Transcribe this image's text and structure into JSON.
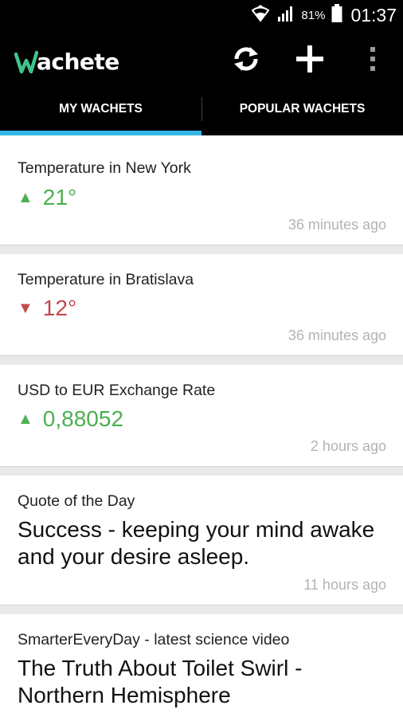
{
  "status_bar": {
    "battery": "81%",
    "time": "01:37"
  },
  "app": {
    "name": "achete"
  },
  "icons": {
    "refresh": "refresh-icon",
    "add": "add-icon",
    "more": "more-vert-icon"
  },
  "tabs": [
    {
      "label": "MY WACHETS",
      "active": true
    },
    {
      "label": "POPULAR WACHETS",
      "active": false
    }
  ],
  "colors": {
    "accent": "#33b5e5",
    "up": "#4cb050",
    "down": "#c44a4a",
    "logo_green": "#3ec48c"
  },
  "wachets": [
    {
      "title": "Temperature in New York",
      "arrow": "▲",
      "value": "21°",
      "trend": "up",
      "time": "36 minutes ago"
    },
    {
      "title": "Temperature in Bratislava",
      "arrow": "▼",
      "value": "12°",
      "trend": "down",
      "time": "36 minutes ago"
    },
    {
      "title": "USD to EUR Exchange Rate",
      "arrow": "▲",
      "value": "0,88052",
      "trend": "up",
      "time": "2 hours ago"
    },
    {
      "title": "Quote of the Day",
      "text": "Success - keeping your mind awake and your desire asleep.",
      "time": "11 hours ago"
    },
    {
      "title": "SmarterEveryDay - latest science video",
      "text": "The Truth About Toilet Swirl - Northern Hemisphere"
    }
  ]
}
